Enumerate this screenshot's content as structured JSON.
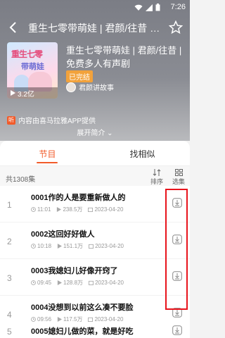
{
  "status": {
    "time": "7:26"
  },
  "header": {
    "title": "重生七零带萌娃 | 君颜/往昔 | 免费多人有声剧"
  },
  "cover": {
    "line1": "重生七零",
    "line2": "带萌娃",
    "plays": "3.2亿"
  },
  "book": {
    "title": "重生七零带萌娃 | 君颜/往昔 | 免费多人有声剧",
    "badge": "已完结",
    "author": "君颜讲故事"
  },
  "source_text": "内容由喜马拉雅APP提供",
  "source_icon": "听",
  "expand_label": "展开简介 ⌄",
  "tabs": {
    "episodes": "节目",
    "similar": "找相似"
  },
  "list": {
    "count": "共1308集",
    "sort_label": "排序",
    "select_label": "选集"
  },
  "episodes": [
    {
      "index": "1",
      "title": "0001作的人是要重新做人的",
      "duration": "11:01",
      "plays": "238.5万",
      "date": "2023-04-20"
    },
    {
      "index": "2",
      "title": "0002这回好好做人",
      "duration": "10:18",
      "plays": "151.1万",
      "date": "2023-04-20"
    },
    {
      "index": "3",
      "title": "0003我媳妇儿好像开窍了",
      "duration": "09:45",
      "plays": "128.8万",
      "date": "2023-04-20"
    },
    {
      "index": "4",
      "title": "0004没想到以前这么凑不要脸",
      "duration": "09:56",
      "plays": "117.5万",
      "date": "2023-04-20"
    },
    {
      "index": "5",
      "title": "0005媳妇儿做的菜，就是好吃",
      "duration": "",
      "plays": "",
      "date": ""
    }
  ],
  "colors": {
    "accent": "#f15b2a",
    "highlight": "#e8131b",
    "badge": "#f2a23b"
  }
}
